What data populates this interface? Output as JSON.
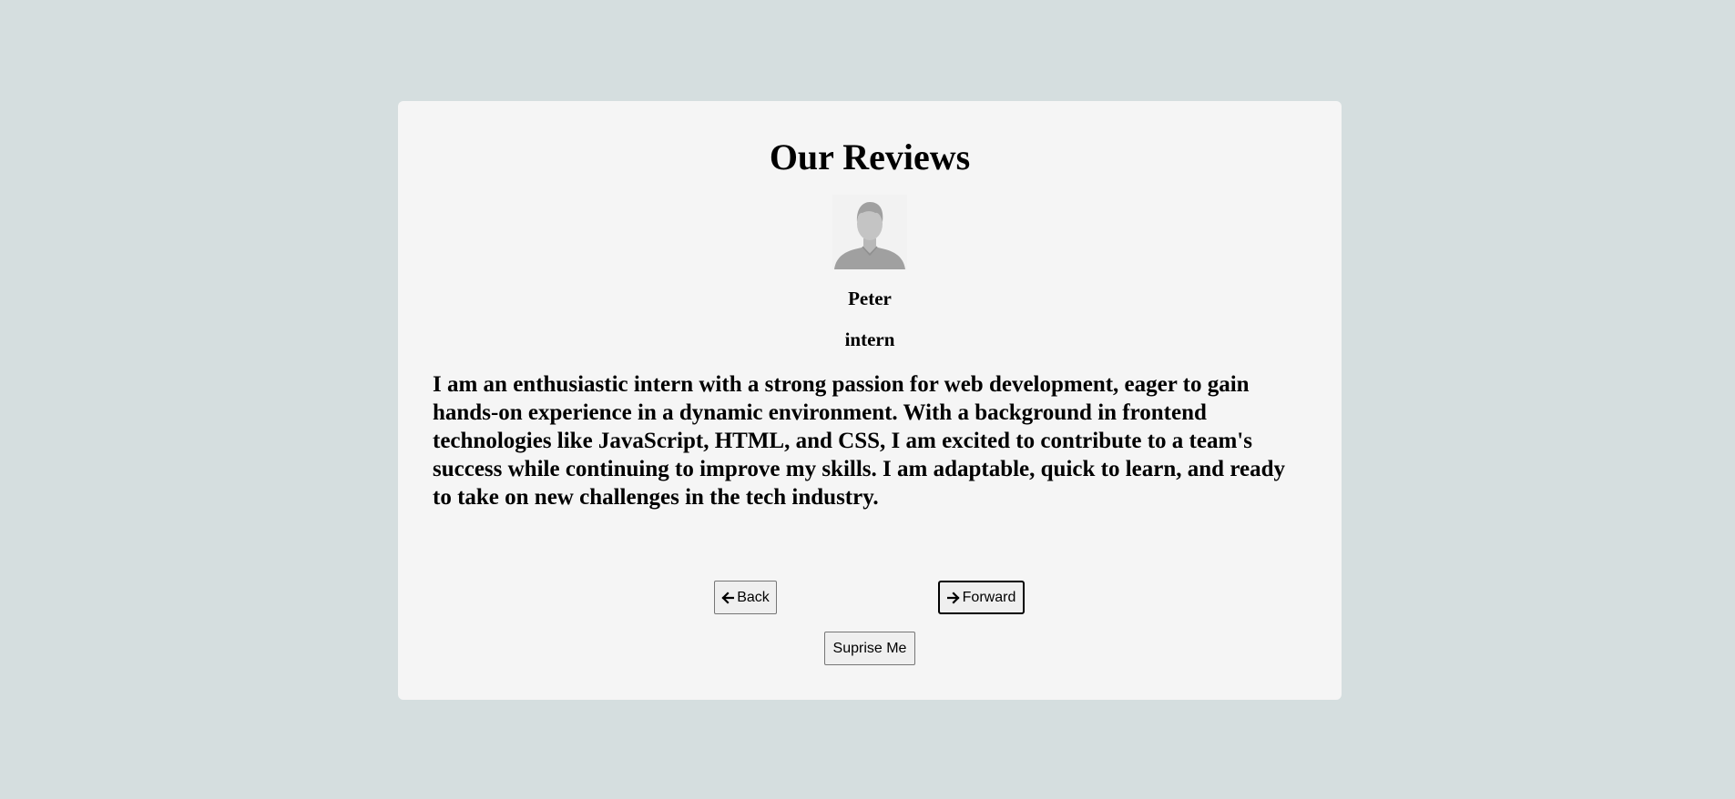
{
  "review_card": {
    "title": "Our Reviews",
    "person": {
      "avatar_icon": "person-silhouette-icon",
      "name": "Peter",
      "role": "intern"
    },
    "text": "I am an enthusiastic intern with a strong passion for web development, eager to gain hands-on experience in a dynamic environment. With a background in frontend technologies like JavaScript, HTML, and CSS, I am excited to contribute to a team's success while continuing to improve my skills. I am adaptable, quick to learn, and ready to take on new challenges in the tech industry."
  },
  "controls": {
    "back_label": "Back",
    "back_icon": "arrow-left-icon",
    "forward_label": "Forward",
    "forward_icon": "arrow-right-icon",
    "surprise_label": "Suprise Me"
  },
  "colors": {
    "page_background": "#d5dedf",
    "card_background": "#f5f5f5",
    "avatar_gray": "#a0a0a0"
  }
}
